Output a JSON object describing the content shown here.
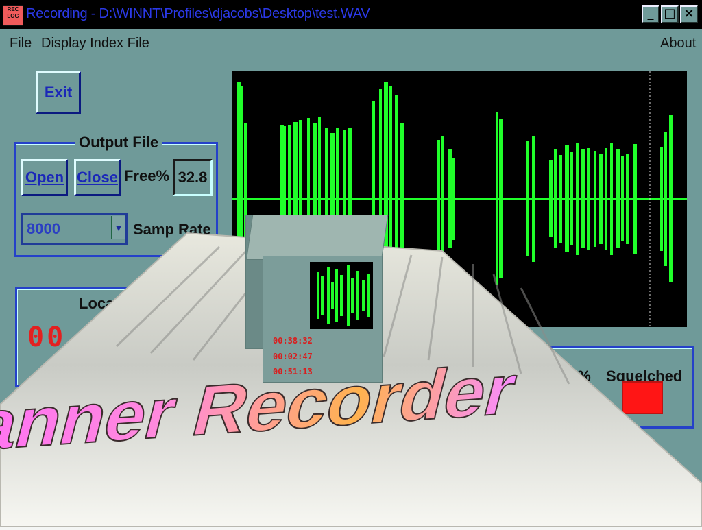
{
  "window": {
    "title": "Recording - D:\\WINNT\\Profiles\\djacobs\\Desktop\\test.WAV",
    "buttons": [
      "minimize",
      "maximize",
      "close"
    ],
    "icon_text": "REC LOG"
  },
  "menu": {
    "file": "File",
    "display_index_file": "Display Index File",
    "about": "About"
  },
  "controls": {
    "exit_label": "Exit",
    "output_file_title": "Output File",
    "open_label": "Open",
    "close_label": "Close",
    "free_percent_label": "Free%",
    "free_percent_value": "32.8",
    "sample_rate_value": "8000",
    "samp_rate_label": "Samp Rate",
    "local_label": "Local",
    "percent_fragment": "0%",
    "squelched_label": "Squelched",
    "lcd_fragment": "00"
  },
  "overlay": {
    "title_text": "Scanner Recorder",
    "cube_lcd": [
      "00:38:32",
      "00:02:47",
      "00:51:13"
    ]
  },
  "colors": {
    "window_bg": "#6f9a99",
    "scope_bg": "#000000",
    "waveform": "#20ff2a",
    "squelch_indicator": "#ff1515",
    "title_text": "#2b39e8"
  }
}
